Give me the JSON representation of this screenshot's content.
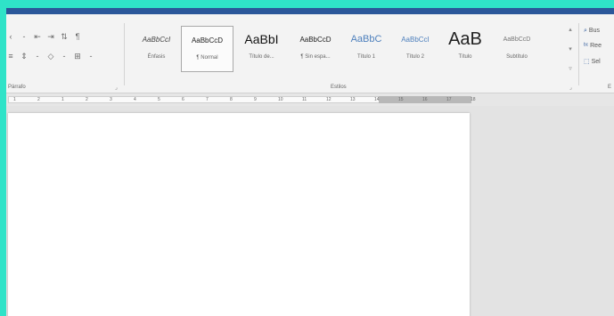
{
  "window": {
    "accent_color": "#2b579a",
    "frame_color": "#2fe3c8"
  },
  "ribbon": {
    "group_labels": {
      "paragraph": "Párrafo",
      "styles": "Estilos",
      "editing": "E"
    },
    "paragraph_controls": {
      "row1": [
        "‹",
        "-",
        "⇤",
        "⇥",
        "⇅",
        "¶"
      ],
      "row2": [
        "≡",
        "⇕",
        "-",
        "◇",
        "-",
        "⊞",
        "-"
      ]
    },
    "styles_gallery": [
      {
        "sample": "AaBbCcI",
        "label": "Énfasis"
      },
      {
        "sample": "AaBbCcD",
        "label": "¶ Normal",
        "selected": true
      },
      {
        "sample": "AaBbI",
        "label": "Título de..."
      },
      {
        "sample": "AaBbCcD",
        "label": "¶ Sin espa..."
      },
      {
        "sample": "AaBbC",
        "label": "Título 1"
      },
      {
        "sample": "AaBbCcI",
        "label": "Título 2"
      },
      {
        "sample": "AaB",
        "label": "Título"
      },
      {
        "sample": "AaBbCcD",
        "label": "Subtítulo"
      }
    ],
    "editing": [
      {
        "icon": "search-icon",
        "glyph": "⌕",
        "label": "Bus"
      },
      {
        "icon": "replace-icon",
        "glyph": "ᵇᶜ",
        "label": "Ree"
      },
      {
        "icon": "select-icon",
        "glyph": "⬚",
        "label": "Sel"
      }
    ]
  },
  "ruler": {
    "numbers": [
      "1",
      "2",
      "1",
      "2",
      "3",
      "4",
      "5",
      "6",
      "7",
      "8",
      "9",
      "10",
      "11",
      "12",
      "13",
      "14",
      "15",
      "16",
      "17",
      "18"
    ]
  }
}
